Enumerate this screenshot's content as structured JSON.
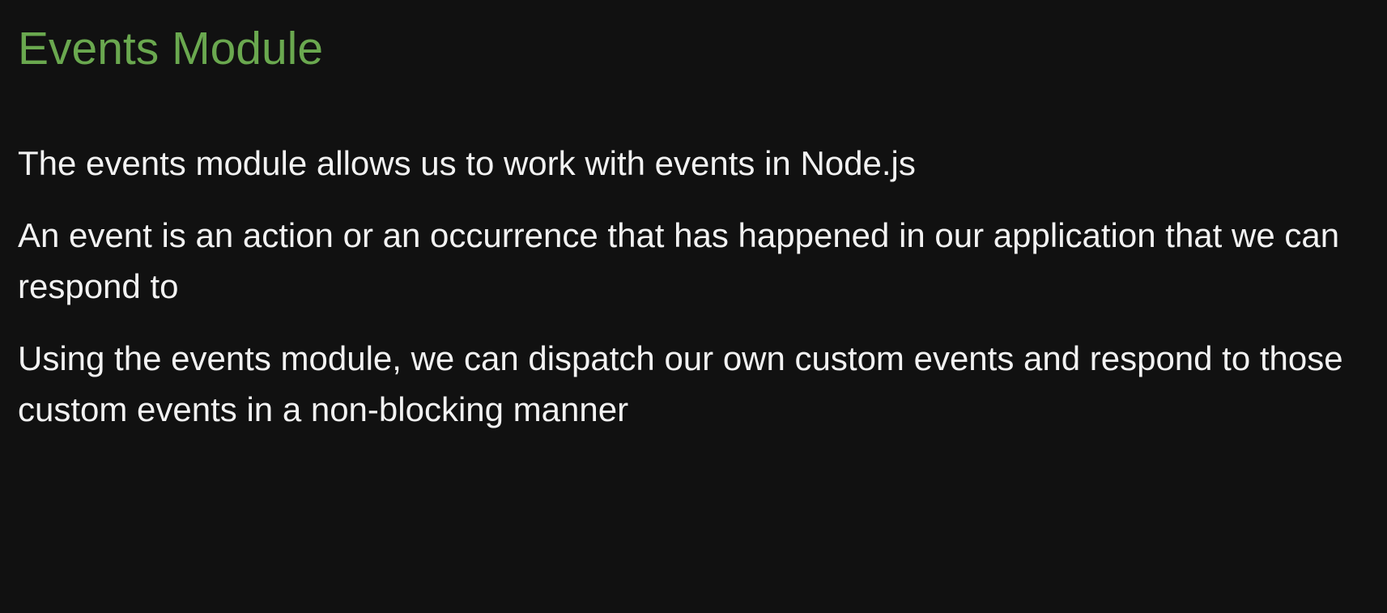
{
  "theme": {
    "background_color": "#111111",
    "title_color": "#6aa84f",
    "text_color": "#f2f2f2"
  },
  "slide": {
    "title": "Events Module",
    "paragraphs": [
      "The events module allows us to work with events in Node.js",
      "An event is an action or an occurrence that has happened in our application that we can respond to",
      "Using the events module, we can dispatch our own custom events and respond to those custom events in a non-blocking manner"
    ]
  }
}
